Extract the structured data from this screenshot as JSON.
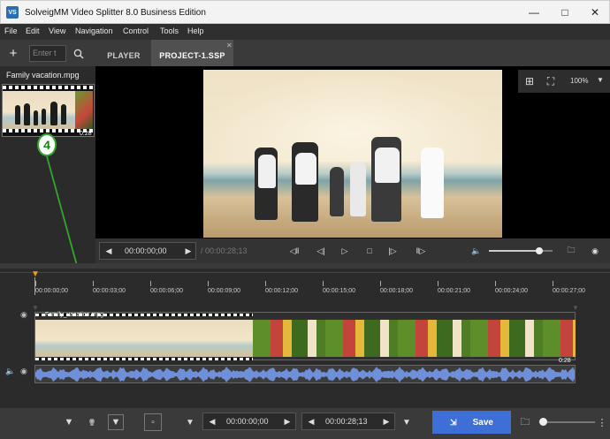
{
  "window": {
    "title": "SolveigMM Video Splitter 8.0 Business Edition",
    "app_icon": "VS"
  },
  "menu": [
    "File",
    "Edit",
    "View",
    "Navigation",
    "Control",
    "Tools",
    "Help"
  ],
  "toolbar": {
    "search_placeholder": "Enter t"
  },
  "tabs": [
    {
      "label": "PLAYER",
      "active": false
    },
    {
      "label": "PROJECT-1.SSP",
      "active": true
    }
  ],
  "media": {
    "filename": "Family vacation.mpg",
    "thumb_duration": "0:28"
  },
  "annotation": {
    "badge": "4",
    "color": "#31a82a"
  },
  "preview": {
    "zoom": "100%"
  },
  "transport": {
    "current_time": "00:00:00;00",
    "total_time": "/ 00:00:28;13"
  },
  "timeline": {
    "ticks": [
      "00:00:00;00",
      "00:00:03;00",
      "00:00:06;00",
      "00:00:09;00",
      "00:00:12;00",
      "00:00:15;00",
      "00:00:18;00",
      "00:00:21;00",
      "00:00:24;00",
      "00:00:27;00"
    ],
    "clip_label": "Family_vacation.mpg",
    "clip_duration": "0:28",
    "playhead_color": "#f39c12",
    "waveform_color": "#6f90d8"
  },
  "bottom": {
    "marker_in": "00:00:00;00",
    "marker_out": "00:00:28;13",
    "save_label": "Save",
    "accent": "#3e6fd6"
  }
}
